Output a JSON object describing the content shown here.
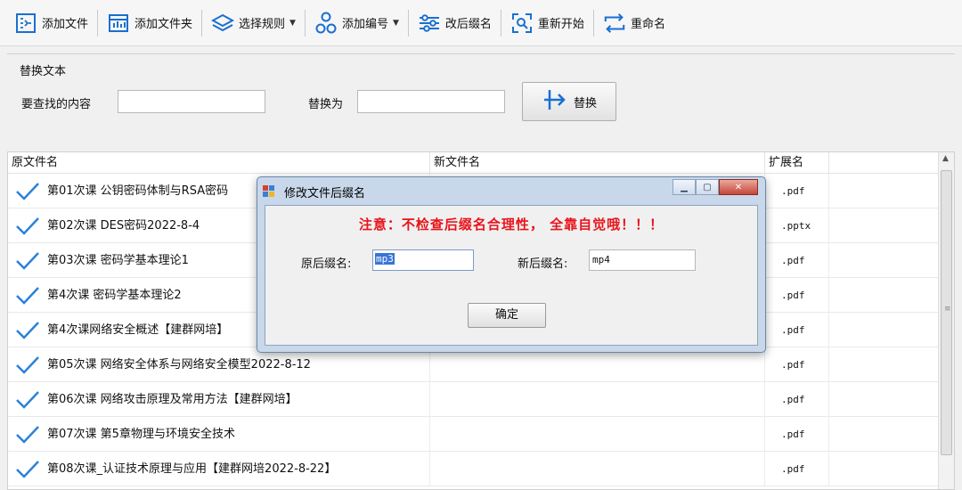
{
  "toolbar": {
    "items": [
      {
        "label": "添加文件",
        "icon": "add-file-icon"
      },
      {
        "label": "添加文件夹",
        "icon": "add-folder-icon"
      },
      {
        "label": "选择规则",
        "icon": "layers-icon",
        "dropdown": true
      },
      {
        "label": "添加编号",
        "icon": "numbering-icon",
        "dropdown": true
      },
      {
        "label": "改后缀名",
        "icon": "sliders-icon"
      },
      {
        "label": "重新开始",
        "icon": "restart-scan-icon"
      },
      {
        "label": "重命名",
        "icon": "swap-arrows-icon"
      }
    ]
  },
  "replace_group": {
    "title": "替换文本",
    "find_label": "要查找的内容",
    "find_value": "",
    "replace_label": "替换为",
    "replace_value": "",
    "button_label": "替换"
  },
  "list": {
    "columns": [
      "原文件名",
      "新文件名",
      "扩展名"
    ],
    "rows": [
      {
        "original": "第01次课 公钥密码体制与RSA密码",
        "new": "",
        "ext": ".pdf"
      },
      {
        "original": "第02次课 DES密码2022-8-4",
        "new": "",
        "ext": ".pptx"
      },
      {
        "original": "第03次课 密码学基本理论1",
        "new": "",
        "ext": ".pdf"
      },
      {
        "original": "第4次课 密码学基本理论2",
        "new": "",
        "ext": ".pdf"
      },
      {
        "original": "第4次课网络安全概述【建群网培】",
        "new": "",
        "ext": ".pdf"
      },
      {
        "original": "第05次课 网络安全体系与网络安全模型2022-8-12",
        "new": "",
        "ext": ".pdf"
      },
      {
        "original": "第06次课 网络攻击原理及常用方法【建群网培】",
        "new": "",
        "ext": ".pdf"
      },
      {
        "original": "第07次课 第5章物理与环境安全技术",
        "new": "",
        "ext": ".pdf"
      },
      {
        "original": "第08次课_认证技术原理与应用【建群网培2022-8-22】",
        "new": "",
        "ext": ".pdf"
      }
    ]
  },
  "dialog": {
    "title": "修改文件后缀名",
    "warning": "注意：不检查后缀名合理性， 全靠自觉哦！！！",
    "orig_label": "原后缀名:",
    "orig_value": "mp3",
    "new_label": "新后缀名:",
    "new_value": "mp4",
    "ok_label": "确定",
    "warning_color": "#e8141b"
  }
}
